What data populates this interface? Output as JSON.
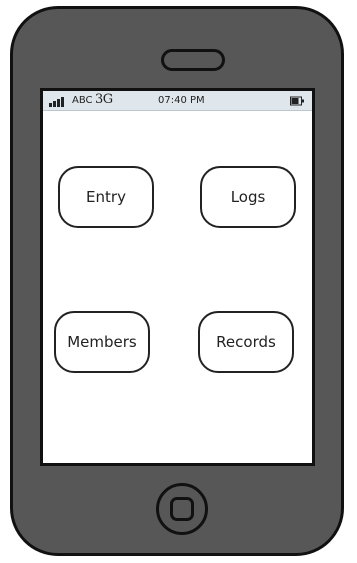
{
  "status_bar": {
    "carrier": "ABC",
    "network": "3G",
    "time": "07:40 PM",
    "signal_icon": "signal-bars-icon",
    "battery_icon": "battery-icon"
  },
  "buttons": {
    "entry": "Entry",
    "logs": "Logs",
    "members": "Members",
    "records": "Records"
  },
  "device": {
    "speaker_icon": "speaker-slot-icon",
    "home_icon": "home-button-icon"
  },
  "colors": {
    "phone_body": "#575757",
    "status_bar_bg": "#dfe7ec",
    "screen_bg": "#ffffff",
    "outline": "#111111"
  }
}
